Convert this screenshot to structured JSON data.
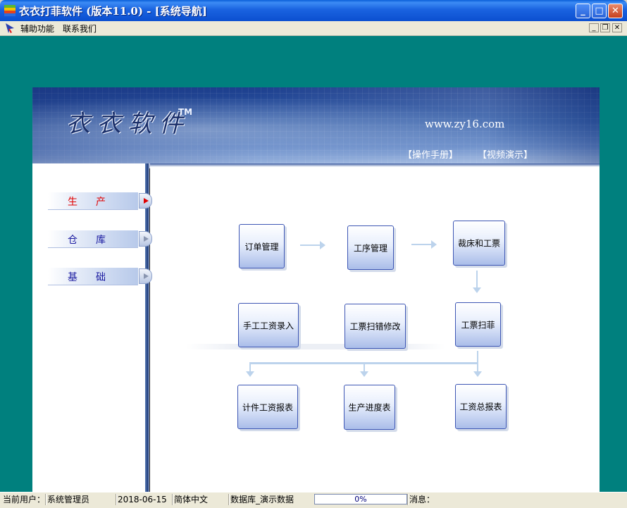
{
  "window": {
    "title": "衣衣打菲软件 (版本11.0) - [系统导航]"
  },
  "menu": {
    "items": [
      "辅助功能",
      "联系我们"
    ]
  },
  "banner": {
    "brand": "衣衣软件",
    "trademark": "TM",
    "website": "www.zy16.com",
    "links": [
      "【操作手册】",
      "【视频演示】"
    ]
  },
  "nav": {
    "items": [
      {
        "label": "生产",
        "active": true
      },
      {
        "label": "仓库",
        "active": false
      },
      {
        "label": "基础",
        "active": false
      }
    ]
  },
  "flow": {
    "nodes": [
      "订单管理",
      "工序管理",
      "裁床和工票",
      "手工工资录入",
      "工票扫错修改",
      "工票扫菲",
      "计件工资报表",
      "生产进度表",
      "工资总报表"
    ]
  },
  "status": {
    "user_label": "当前用户：",
    "user": "系统管理员",
    "date": "2018-06-15",
    "language": "简体中文",
    "database": "数据库_演示数据",
    "progress_text": "0%",
    "progress_value": 0,
    "message_label": "消息："
  },
  "colors": {
    "workspace": "#00807e",
    "titlebar": "#0b4fd0",
    "active_nav": "#e00000",
    "nav_text": "#1a1aa0"
  }
}
